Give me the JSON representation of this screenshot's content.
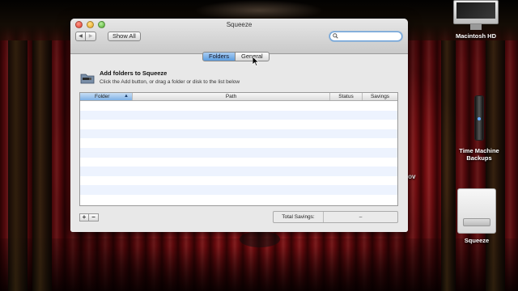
{
  "window": {
    "title": "Squeeze",
    "show_all_label": "Show All",
    "nav_back": "◀",
    "nav_forward": "▶",
    "search_placeholder": ""
  },
  "tabs": [
    {
      "label": "Folders",
      "selected": true
    },
    {
      "label": "General",
      "selected": false
    }
  ],
  "header": {
    "title": "Add folders to Squeeze",
    "subtitle": "Click the Add button, or drag a folder or disk to the list below"
  },
  "table": {
    "columns": [
      "Folder",
      "Path",
      "Status",
      "Savings"
    ],
    "sort_column": "Folder",
    "sort_indicator": "▲",
    "rows": []
  },
  "footer": {
    "add_label": "+",
    "remove_label": "−",
    "total_label": "Total Savings:",
    "total_value": "–"
  },
  "desktop": {
    "icons": [
      {
        "label": "Macintosh HD",
        "icon": "imac-hd-icon"
      },
      {
        "label": "Time Machine Backups",
        "icon": "time-machine-drive-icon"
      },
      {
        "label": "Squeeze",
        "icon": "disk-image-icon"
      }
    ],
    "partial_label": "mov"
  },
  "colors": {
    "selected_tab": "#5d9ee0",
    "alt_row": "#edf3fe",
    "search_focus": "#6aa0d8"
  }
}
